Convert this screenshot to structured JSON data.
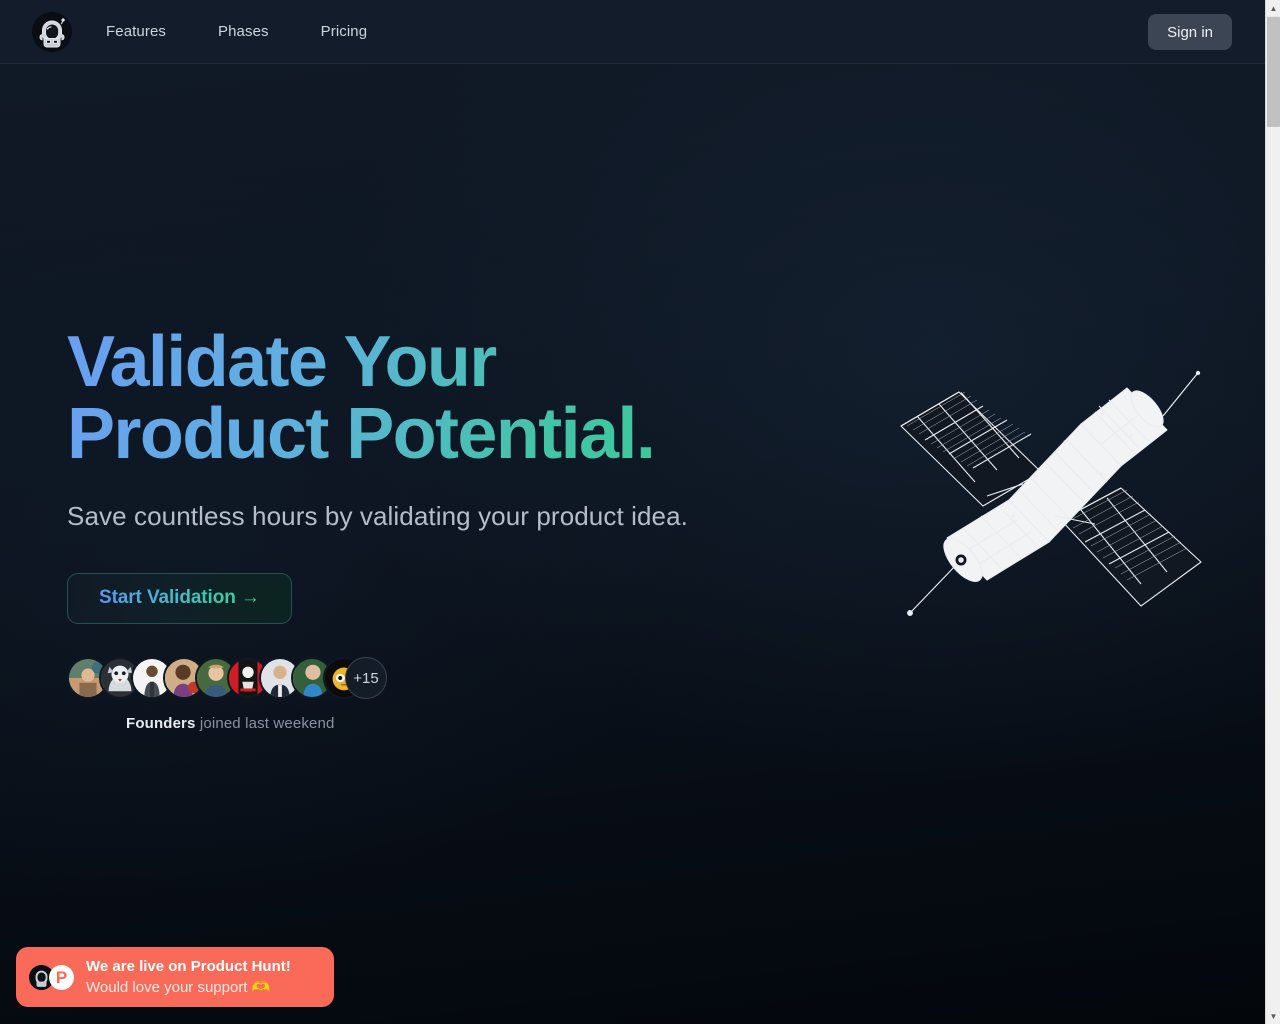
{
  "header": {
    "logo_icon": "astronaut-helmet-logo",
    "nav": [
      {
        "label": "Features"
      },
      {
        "label": "Phases"
      },
      {
        "label": "Pricing"
      }
    ],
    "signin_label": "Sign in"
  },
  "hero": {
    "headline": "Validate Your\nProduct Potential.",
    "headline_line1": "Validate Your",
    "headline_line2": "Product Potential.",
    "subtitle": "Save countless hours by validating your product idea.",
    "cta_label": "Start Validation →",
    "illustration": "satellite-line-art"
  },
  "social_proof": {
    "avatar_count": 10,
    "more_label": "+15",
    "caption_strong": "Founders",
    "caption_rest": " joined last weekend",
    "avatars": [
      {
        "name": "avatar-1",
        "colors": [
          "#6f8a6a",
          "#caa58c",
          "#3e5f72"
        ]
      },
      {
        "name": "avatar-2",
        "colors": [
          "#9aa0a6",
          "#d8dde2",
          "#b0343a"
        ]
      },
      {
        "name": "avatar-3",
        "colors": [
          "#f2f2f2",
          "#4a4f58",
          "#2d323a"
        ]
      },
      {
        "name": "avatar-4",
        "colors": [
          "#c9a57f",
          "#6a3d6e",
          "#c0392b"
        ]
      },
      {
        "name": "avatar-5",
        "colors": [
          "#5d7f53",
          "#e8c3a0",
          "#2f4a6b"
        ]
      },
      {
        "name": "avatar-6",
        "colors": [
          "#cf1d26",
          "#1a1a1a",
          "#e8e8e8"
        ]
      },
      {
        "name": "avatar-7",
        "colors": [
          "#dfe3e8",
          "#21293a",
          "#8d949f"
        ]
      },
      {
        "name": "avatar-8",
        "colors": [
          "#3b6b3f",
          "#2f87c8",
          "#e3bfa2"
        ]
      },
      {
        "name": "avatar-9",
        "colors": [
          "#0b0b0b",
          "#f0b429",
          "#ffffff"
        ]
      }
    ]
  },
  "product_hunt_banner": {
    "logo_icon": "astronaut-helmet-logo",
    "mark_letter": "P",
    "title": "We are live on Product Hunt!",
    "subtitle": "Would love your support 🫶"
  },
  "scrollbar": {
    "up_arrow": "▲",
    "down_arrow": "▼"
  },
  "colors": {
    "page_bg": "#0b121c",
    "header_bg": "#131c2b",
    "accent_blue": "#6a9ef2",
    "accent_green": "#38cb93",
    "banner_bg": "#fa6a59",
    "signin_bg": "#3b4554"
  }
}
